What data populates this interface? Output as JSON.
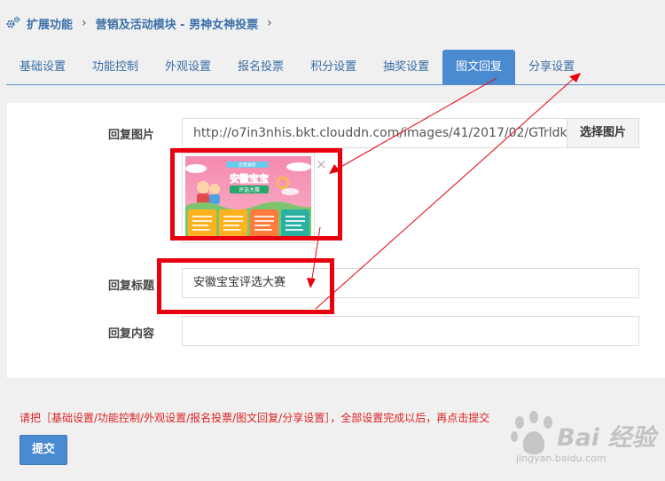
{
  "breadcrumb": {
    "level1": "扩展功能",
    "level2": "营销及活动模块 - 男神女神投票",
    "trailing_chevron": "›"
  },
  "tabs": [
    {
      "label": "基础设置",
      "active": false
    },
    {
      "label": "功能控制",
      "active": false
    },
    {
      "label": "外观设置",
      "active": false
    },
    {
      "label": "报名投票",
      "active": false
    },
    {
      "label": "积分设置",
      "active": false
    },
    {
      "label": "抽奖设置",
      "active": false
    },
    {
      "label": "图文回复",
      "active": true
    },
    {
      "label": "分享设置",
      "active": false
    }
  ],
  "form": {
    "image_label": "回复图片",
    "image_url": "http://o7in3nhis.bkt.clouddn.com/images/41/2017/02/GTrldk",
    "choose_image_button": "选择图片",
    "image_thumbnail": {
      "top_ribbon": "合肥兼职",
      "title_line1": "安徽宝宝",
      "title_line2": "评选大赛",
      "remove_glyph": "×"
    },
    "title_label": "回复标题",
    "title_value": "安徽宝宝评选大赛",
    "content_label": "回复内容",
    "content_value": ""
  },
  "note": "请把［基础设置/功能控制/外观设置/报名投票/图文回复/分享设置］，全部设置完成以后，再点击提交",
  "submit_button": "提交",
  "watermark": {
    "brand": "Bai 经验",
    "url": "jingyan.baidu.com"
  },
  "colors": {
    "accent": "#4a8ad0",
    "link": "#3b6ea5",
    "annotation_red": "#e8000f",
    "note_red": "#dd2222"
  },
  "icons": [
    "gear-icon",
    "chevron-right-icon",
    "close-icon"
  ]
}
